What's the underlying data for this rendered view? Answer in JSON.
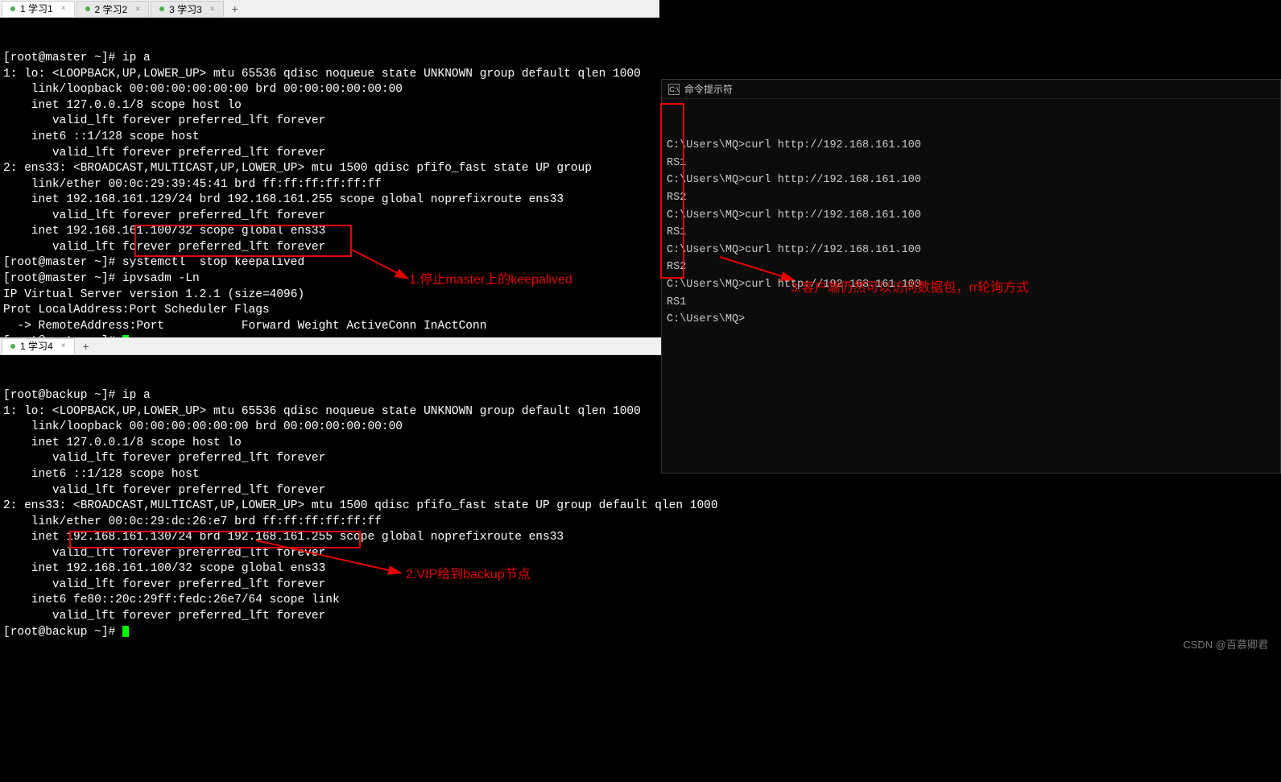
{
  "tabs_top": [
    {
      "dot": true,
      "label": "1 学习1",
      "active": true
    },
    {
      "dot": true,
      "label": "2 学习2",
      "active": false
    },
    {
      "dot": true,
      "label": "3 学习3",
      "active": false
    }
  ],
  "tabs_bottom": [
    {
      "dot": true,
      "label": "1 学习4",
      "active": true
    }
  ],
  "master": {
    "lines": [
      "[root@master ~]# ip a",
      "1: lo: <LOOPBACK,UP,LOWER_UP> mtu 65536 qdisc noqueue state UNKNOWN group default qlen 1000",
      "    link/loopback 00:00:00:00:00:00 brd 00:00:00:00:00:00",
      "    inet 127.0.0.1/8 scope host lo",
      "       valid_lft forever preferred_lft forever",
      "    inet6 ::1/128 scope host ",
      "       valid_lft forever preferred_lft forever",
      "2: ens33: <BROADCAST,MULTICAST,UP,LOWER_UP> mtu 1500 qdisc pfifo_fast state UP group",
      "    link/ether 00:0c:29:39:45:41 brd ff:ff:ff:ff:ff:ff",
      "    inet 192.168.161.129/24 brd 192.168.161.255 scope global noprefixroute ens33",
      "       valid_lft forever preferred_lft forever",
      "    inet 192.168.161.100/32 scope global ens33",
      "       valid_lft forever preferred_lft forever",
      "[root@master ~]# systemctl  stop keepalived",
      "[root@master ~]# ipvsadm -Ln",
      "IP Virtual Server version 1.2.1 (size=4096)",
      "Prot LocalAddress:Port Scheduler Flags",
      "  -> RemoteAddress:Port           Forward Weight ActiveConn InActConn",
      "[root@master ~]# "
    ]
  },
  "backup": {
    "lines": [
      "[root@backup ~]# ip a",
      "1: lo: <LOOPBACK,UP,LOWER_UP> mtu 65536 qdisc noqueue state UNKNOWN group default qlen 1000",
      "    link/loopback 00:00:00:00:00:00 brd 00:00:00:00:00:00",
      "    inet 127.0.0.1/8 scope host lo",
      "       valid_lft forever preferred_lft forever",
      "    inet6 ::1/128 scope host ",
      "       valid_lft forever preferred_lft forever",
      "2: ens33: <BROADCAST,MULTICAST,UP,LOWER_UP> mtu 1500 qdisc pfifo_fast state UP group default qlen 1000",
      "    link/ether 00:0c:29:dc:26:e7 brd ff:ff:ff:ff:ff:ff",
      "    inet 192.168.161.130/24 brd 192.168.161.255 scope global noprefixroute ens33",
      "       valid_lft forever preferred_lft forever",
      "    inet 192.168.161.100/32 scope global ens33",
      "       valid_lft forever preferred_lft forever",
      "    inet6 fe80::20c:29ff:fedc:26e7/64 scope link ",
      "       valid_lft forever preferred_lft forever",
      "[root@backup ~]# "
    ]
  },
  "cmd": {
    "title": "命令提示符",
    "lines": [
      "C:\\Users\\MQ>curl http://192.168.161.100",
      "RS1",
      "",
      "C:\\Users\\MQ>curl http://192.168.161.100",
      "RS2",
      "",
      "C:\\Users\\MQ>curl http://192.168.161.100",
      "RS1",
      "",
      "C:\\Users\\MQ>curl http://192.168.161.100",
      "RS2",
      "",
      "C:\\Users\\MQ>curl http://192.168.161.100",
      "RS1",
      "",
      "C:\\Users\\MQ>"
    ]
  },
  "annotations": {
    "a1": "1.停止master上的keepalived",
    "a2": "2.VIP给到backup节点",
    "a3": "3.客户端仍然可以访问数据包，rr轮询方式"
  },
  "watermark": "CSDN @百慕卿君"
}
